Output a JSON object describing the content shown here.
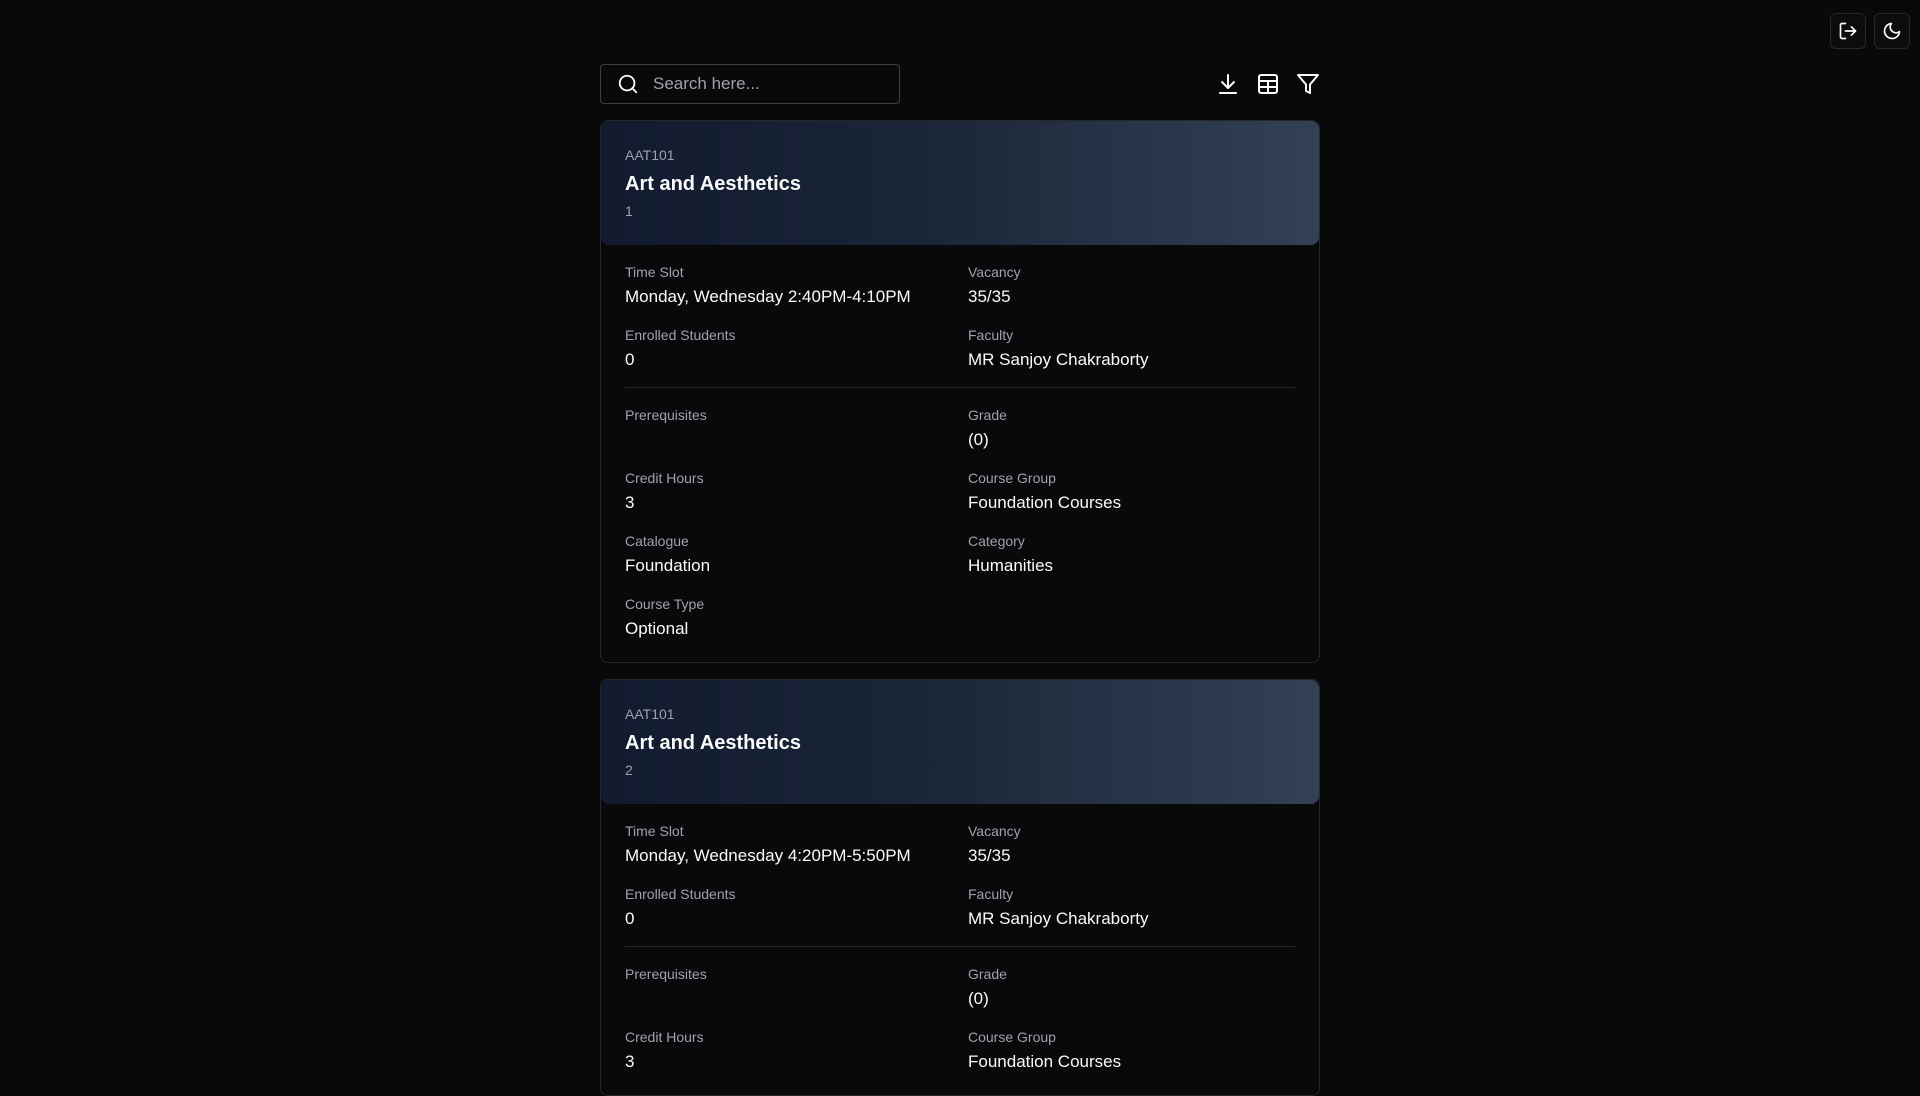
{
  "search": {
    "placeholder": "Search here..."
  },
  "courses": [
    {
      "code": "AAT101",
      "title": "Art and Aesthetics",
      "section": "1",
      "time_slot_label": "Time Slot",
      "time_slot": "Monday, Wednesday 2:40PM-4:10PM",
      "vacancy_label": "Vacancy",
      "vacancy": "35/35",
      "enrolled_label": "Enrolled Students",
      "enrolled": "0",
      "faculty_label": "Faculty",
      "faculty": "MR Sanjoy Chakraborty",
      "prerequisites_label": "Prerequisites",
      "prerequisites": "",
      "grade_label": "Grade",
      "grade": "(0)",
      "credit_hours_label": "Credit Hours",
      "credit_hours": "3",
      "course_group_label": "Course Group",
      "course_group": "Foundation Courses",
      "catalogue_label": "Catalogue",
      "catalogue": "Foundation",
      "category_label": "Category",
      "category": "Humanities",
      "course_type_label": "Course Type",
      "course_type": "Optional"
    },
    {
      "code": "AAT101",
      "title": "Art and Aesthetics",
      "section": "2",
      "time_slot_label": "Time Slot",
      "time_slot": "Monday, Wednesday 4:20PM-5:50PM",
      "vacancy_label": "Vacancy",
      "vacancy": "35/35",
      "enrolled_label": "Enrolled Students",
      "enrolled": "0",
      "faculty_label": "Faculty",
      "faculty": "MR Sanjoy Chakraborty",
      "prerequisites_label": "Prerequisites",
      "prerequisites": "",
      "grade_label": "Grade",
      "grade": "(0)",
      "credit_hours_label": "Credit Hours",
      "credit_hours": "3",
      "course_group_label": "Course Group",
      "course_group": "Foundation Courses"
    }
  ]
}
